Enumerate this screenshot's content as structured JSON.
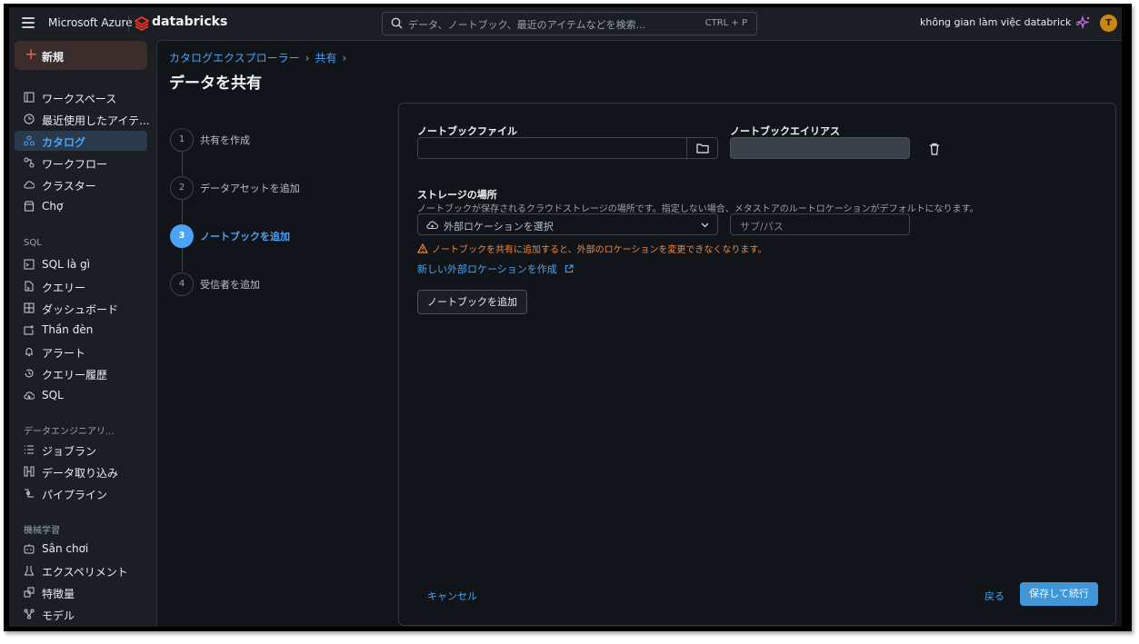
{
  "topbar": {
    "brand_ms": "Microsoft Azure",
    "brand_db": "databricks",
    "search_placeholder": "データ、ノートブック、最近のアイテムなどを検索...",
    "search_shortcut": "CTRL + P",
    "workspace": "không gian làm việc databrick",
    "avatar_initial": "T"
  },
  "sidebar": {
    "new_label": "新規",
    "items": [
      {
        "label": "ワークスペース",
        "icon": "workspace-icon"
      },
      {
        "label": "最近使用したアイテ...",
        "icon": "clock-icon"
      },
      {
        "label": "カタログ",
        "icon": "catalog-icon"
      },
      {
        "label": "ワークフロー",
        "icon": "workflow-icon"
      },
      {
        "label": "クラスター",
        "icon": "cloud-icon"
      },
      {
        "label": "Chợ",
        "icon": "market-icon"
      }
    ],
    "sql_section": "SQL",
    "sql_items": [
      {
        "label": "SQL là gì",
        "icon": "sql-editor-icon"
      },
      {
        "label": "クエリー",
        "icon": "query-icon"
      },
      {
        "label": "ダッシュボード",
        "icon": "dashboard-icon"
      },
      {
        "label": "Thần đèn",
        "icon": "genie-icon"
      },
      {
        "label": "アラート",
        "icon": "bell-icon"
      },
      {
        "label": "クエリー履歴",
        "icon": "history-icon"
      },
      {
        "label": "SQL",
        "icon": "sql-warehouse-icon"
      }
    ],
    "de_section": "データエンジニアリ...",
    "de_items": [
      {
        "label": "ジョブラン",
        "icon": "job-runs-icon"
      },
      {
        "label": "データ取り込み",
        "icon": "ingest-icon"
      },
      {
        "label": "パイプライン",
        "icon": "pipeline-icon"
      }
    ],
    "ml_section": "機械学習",
    "ml_items": [
      {
        "label": "Sân chơi",
        "icon": "playground-icon"
      },
      {
        "label": "エクスペリメント",
        "icon": "experiment-icon"
      },
      {
        "label": "特徴量",
        "icon": "features-icon"
      },
      {
        "label": "モデル",
        "icon": "model-icon"
      }
    ]
  },
  "main": {
    "breadcrumb": [
      "カタログエクスプローラー",
      "共有"
    ],
    "title": "データを共有",
    "steps": [
      {
        "num": "1",
        "label": "共有を作成"
      },
      {
        "num": "2",
        "label": "データアセットを追加"
      },
      {
        "num": "3",
        "label": "ノートブックを追加"
      },
      {
        "num": "4",
        "label": "受信者を追加"
      }
    ]
  },
  "form": {
    "notebook_file_label": "ノートブックファイル",
    "notebook_file_value": "",
    "notebook_alias_label": "ノートブックエイリアス",
    "notebook_alias_value": "",
    "storage_label": "ストレージの場所",
    "storage_help": "ノートブックが保存されるクラウドストレージの場所です。指定しない場合、メタストアのルートロケーションがデフォルトになります。",
    "location_placeholder": "外部ロケーションを選択",
    "subpath_placeholder": "サブ/パス",
    "warning": "ノートブックを共有に追加すると、外部のロケーションを変更できなくなります。",
    "new_location_link": "新しい外部ロケーションを作成",
    "add_notebook_button": "ノートブックを追加",
    "cancel": "キャンセル",
    "back": "戻る",
    "save_continue": "保存して続行"
  },
  "colors": {
    "accent": "#4ba3f5",
    "warning": "#f0883e",
    "new_plus": "#ff5f4a",
    "avatar": "#c98710"
  }
}
